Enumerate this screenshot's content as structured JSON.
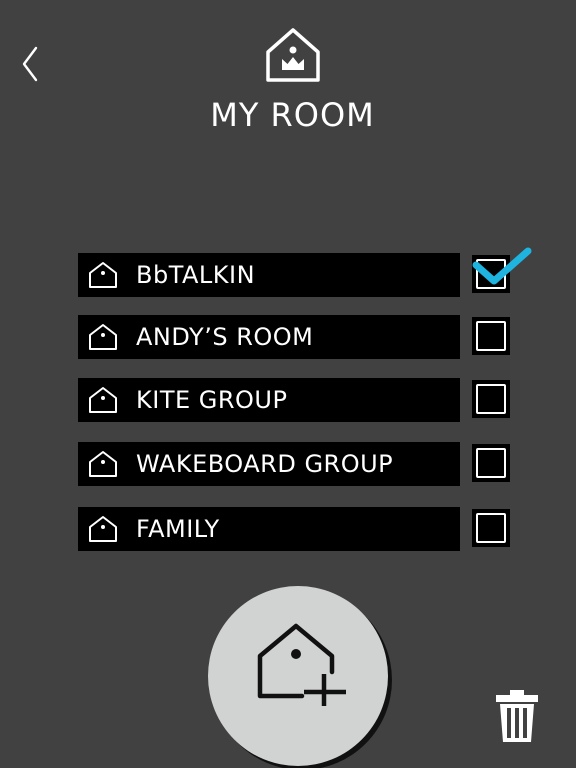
{
  "header": {
    "title": "MY ROOM",
    "back_icon": "chevron-left-icon",
    "room_icon": "house-crown-icon"
  },
  "rooms": [
    {
      "label": "BbTALKIN",
      "checked": true
    },
    {
      "label": "ANDY’S ROOM",
      "checked": false
    },
    {
      "label": "KITE GROUP",
      "checked": false
    },
    {
      "label": "WAKEBOARD GROUP",
      "checked": false
    },
    {
      "label": "FAMILY",
      "checked": false
    }
  ],
  "actions": {
    "add_icon": "house-plus-icon",
    "delete_icon": "trash-icon"
  },
  "colors": {
    "background": "#414141",
    "row": "#000000",
    "check_accent": "#1fb4e0",
    "add_button": "#d1d3d2"
  }
}
